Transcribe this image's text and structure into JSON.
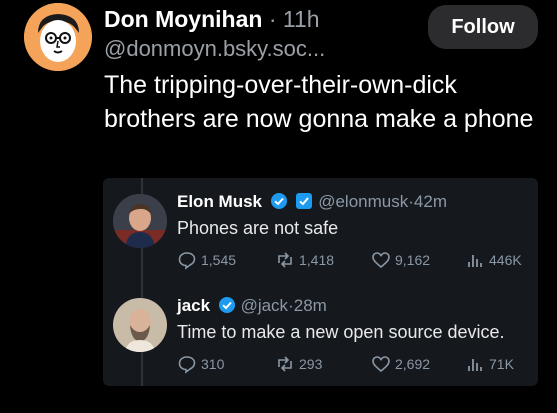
{
  "post": {
    "author_name": "Don Moynihan",
    "separator": "·",
    "time": "11h",
    "handle": "@donmoyn.bsky.soc...",
    "follow_label": "Follow",
    "text": "The tripping-over-their-own-dick brothers are now gonna make a phone"
  },
  "quoted_thread": [
    {
      "name": "Elon Musk",
      "handle": "@elonmusk",
      "separator": "·",
      "time": "42m",
      "text": "Phones are not safe",
      "replies": "1,545",
      "reposts": "1,418",
      "likes": "9,162",
      "views": "446K"
    },
    {
      "name": "jack",
      "handle": "@jack",
      "separator": "·",
      "time": "28m",
      "text": "Time to make a new open source device.",
      "replies": "310",
      "reposts": "293",
      "likes": "2,692",
      "views": "71K"
    }
  ],
  "colors": {
    "background": "#000000",
    "embed_background": "#15181d",
    "muted_text": "#8b98a5",
    "verified_blue": "#1d9bf0",
    "follow_button": "#2c2c2e"
  },
  "icons": [
    "avatar-cartoon",
    "verified-badge-icon",
    "affiliate-badge-icon",
    "reply-icon",
    "repost-icon",
    "like-icon",
    "views-icon"
  ]
}
